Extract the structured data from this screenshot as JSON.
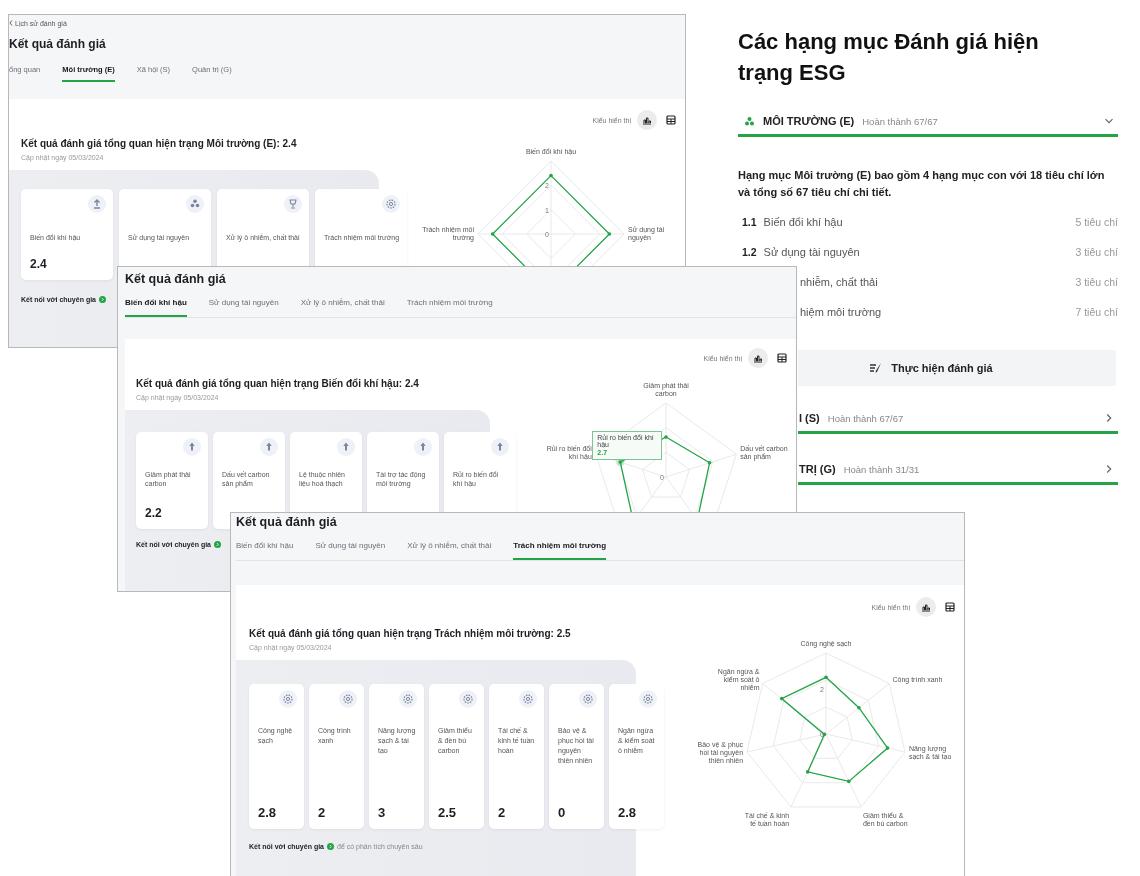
{
  "history_window": {
    "breadcrumb": "Lịch sử đánh giá",
    "title": "Kết quả đánh giá",
    "tabs": [
      {
        "label": "ổng quan",
        "selected": false
      },
      {
        "label": "Môi trường (E)",
        "selected": true
      },
      {
        "label": "Xã hội (S)",
        "selected": false
      },
      {
        "label": "Quản trị (G)",
        "selected": false
      }
    ],
    "view_label": "Kiểu hiển thị",
    "views": [
      {
        "kind": "chart",
        "selected": true
      },
      {
        "kind": "table",
        "selected": false
      }
    ],
    "heading": "Kết quả đánh giá tổng quan hiện trạng Môi trường (E): 2.4",
    "updated": "Cập nhật ngày 05/03/2024",
    "cards": [
      {
        "kind": "upload",
        "label": "Biến đổi khí hậu",
        "score": "2.4"
      },
      {
        "kind": "tree",
        "label": "Sử dụng tài nguyên"
      },
      {
        "kind": "trophy",
        "label": "Xử lý ô nhiễm, chất thải"
      },
      {
        "kind": "gear",
        "label": "Trách nhiệm môi trường"
      }
    ],
    "expert_link": "Kết nối với chuyên gia",
    "radar": {
      "axis_labels": [
        "Biến đổi khí hậu",
        "Trách nhiệm môi trường",
        "Sử dụng tài nguyên"
      ],
      "ticks": [
        "2",
        "1",
        "0"
      ]
    }
  },
  "esg_panel": {
    "title": "Các hạng mục Đánh giá hiện trạng ESG",
    "sections": [
      {
        "kind": "full",
        "title": "MÔI TRƯỜNG (E)",
        "status": "Hoàn thành 67/67",
        "expanded": true,
        "description": "Hạng mục Môi trường (E) bao gồm 4 hạng mục con với 18 tiêu chí lớn và tổng số 67 tiêu chí chi tiết.",
        "items": [
          {
            "kind": "full",
            "number": "1.1",
            "label": "Biến đổi khí hậu",
            "count": "5 tiêu chí"
          },
          {
            "kind": "full",
            "number": "1.2",
            "label": "Sử dụng tài nguyên",
            "count": "3 tiêu chí"
          },
          {
            "kind": "covered",
            "label": "nhiễm, chất thải",
            "count": "3 tiêu chí"
          },
          {
            "kind": "covered",
            "label": "hiệm môi trường",
            "count": "7 tiêu chí"
          }
        ],
        "action": "Thực hiện đánh giá"
      },
      {
        "kind": "covered",
        "title": "I (S)",
        "status": "Hoàn thành 67/67",
        "expanded": false
      },
      {
        "kind": "covered",
        "title": "TRỊ (G)",
        "status": "Hoàn thành 31/31",
        "expanded": false
      }
    ]
  },
  "climate_window": {
    "title": "Kết quả đánh giá",
    "tabs": [
      {
        "label": "Biến đổi khí hậu",
        "selected": true
      },
      {
        "label": "Sử dụng tài nguyên",
        "selected": false
      },
      {
        "label": "Xử lý ô nhiễm, chất thải",
        "selected": false
      },
      {
        "label": "Trách nhiệm môi trường",
        "selected": false
      }
    ],
    "view_label": "Kiểu hiển thị",
    "views": [
      {
        "kind": "chart",
        "selected": true
      },
      {
        "kind": "table",
        "selected": false
      }
    ],
    "heading": "Kết quả đánh giá tổng quan hiện trạng Biến đổi khí hậu: 2.4",
    "updated": "Cập nhật ngày 05/03/2024",
    "cards": [
      {
        "kind": "arrow_up",
        "label": "Giảm phát thải carbon",
        "score": "2.2"
      },
      {
        "kind": "arrow_up",
        "label": "Dấu vết carbon sản phẩm"
      },
      {
        "kind": "arrow_up",
        "label": "Lệ thuộc nhiên liệu hoá thạch"
      },
      {
        "kind": "arrow_up",
        "label": "Tài trợ tác động môi trường"
      },
      {
        "kind": "arrow_up",
        "label": "Rủi ro biến đổi khí hậu"
      }
    ],
    "expert_link": "Kết nối với chuyên gia",
    "radar": {
      "axis_labels": [
        "Giảm phát thải carbon",
        "Rủi ro biến đổi khí hậu",
        "Dấu vết carbon sản phẩm"
      ],
      "ticks": [
        "0"
      ],
      "tooltip": {
        "label": "Rủi ro biến đổi khí hậu",
        "value": "2.7"
      }
    }
  },
  "responsibility_window": {
    "title": "Kết quả đánh giá",
    "tabs": [
      {
        "label": "Biến đổi khí hậu",
        "selected": false
      },
      {
        "label": "Sử dụng tài nguyên",
        "selected": false
      },
      {
        "label": "Xử lý ô nhiễm, chất thải",
        "selected": false
      },
      {
        "label": "Trách nhiệm môi trường",
        "selected": true
      }
    ],
    "view_label": "Kiểu hiển thị",
    "views": [
      {
        "kind": "chart",
        "selected": true
      },
      {
        "kind": "table",
        "selected": false
      }
    ],
    "heading": "Kết quả đánh giá tổng quan hiện trạng Trách nhiệm môi trường: 2.5",
    "updated": "Cập nhật ngày 05/03/2024",
    "cards": [
      {
        "kind": "gear",
        "label": "Công nghệ sạch",
        "score": "2.8"
      },
      {
        "kind": "gear",
        "label": "Công trình xanh",
        "score": "2"
      },
      {
        "kind": "gear",
        "label": "Năng lượng sạch & tái tạo",
        "score": "3"
      },
      {
        "kind": "gear",
        "label": "Giảm thiểu & đền bù carbon",
        "score": "2.5"
      },
      {
        "kind": "gear",
        "label": "Tái chế & kinh tế tuần hoàn",
        "score": "2"
      },
      {
        "kind": "gear",
        "label": "Bảo vệ & phục hồi tài nguyên thiên nhiên",
        "score": "0"
      },
      {
        "kind": "gear",
        "label": "Ngăn ngừa & kiểm soát ô nhiễm",
        "score": "2.8"
      }
    ],
    "expert_link": "Kết nối với chuyên gia",
    "expert_note": "để có phân tích chuyên sâu",
    "radar": {
      "axis_labels": [
        "Công nghệ sạch",
        "Ngăn ngừa & kiểm soát ô nhiễm",
        "Công trình xanh",
        "Bảo vệ & phục hồi tài nguyên thiên nhiên",
        "Năng lượng sạch & tái tạo",
        "Tái chế & kinh tế tuần hoàn",
        "Giảm thiểu & đền bù carbon"
      ],
      "ticks": [
        "2",
        "0"
      ]
    }
  }
}
